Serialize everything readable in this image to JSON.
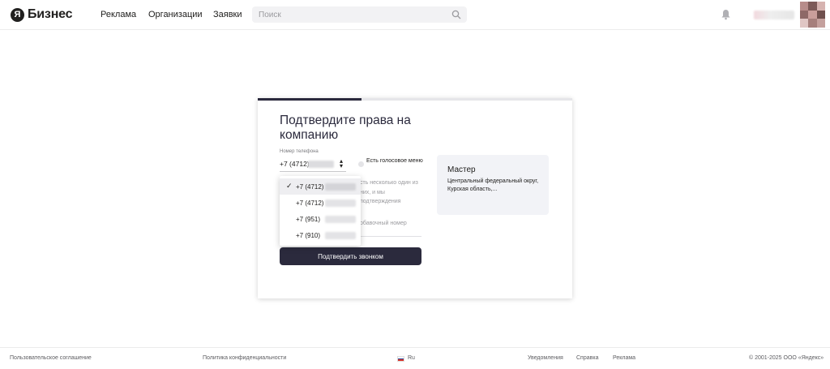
{
  "header": {
    "logo_badge": "Я",
    "logo_text": "Бизнес",
    "nav": [
      "Реклама",
      "Организации",
      "Заявки"
    ],
    "search_placeholder": "Поиск",
    "icons": [
      "search-icon",
      "bell-icon"
    ]
  },
  "card": {
    "title": "Подтвердите права на компанию",
    "progress_fraction": 0.33,
    "phone_label": "Номер телефона",
    "phone_value": "+7 (4712)",
    "voice_menu_label": "Есть голосовое меню",
    "hint_text": "сть несколько один из них, и мы подтверждения",
    "extension_link": "обавочный номер",
    "confirm_button": "Подтвердить звонком",
    "master": {
      "title": "Мастер",
      "description": "Центральный федеральный округ, Курская область,..."
    }
  },
  "dropdown": {
    "items": [
      {
        "prefix": "+7 (4712)",
        "selected": true
      },
      {
        "prefix": "+7 (4712)",
        "selected": false
      },
      {
        "prefix": "+7 (951)",
        "selected": false
      },
      {
        "prefix": "+7 (910)",
        "selected": false
      }
    ],
    "check_mark": "✓"
  },
  "footer": {
    "user_agreement": "Пользовательское соглашение",
    "privacy_policy": "Политика конфиденциальности",
    "language": "Ru",
    "notifications": "Уведомления",
    "help": "Справка",
    "advertising": "Реклама",
    "copyright": "© 2001-2025 ООО «Яндекс»"
  },
  "colors": {
    "primary": "#2b2a3d",
    "master_bg": "#f2f3f7",
    "text": "#21201f",
    "muted": "#9a9a9e"
  }
}
